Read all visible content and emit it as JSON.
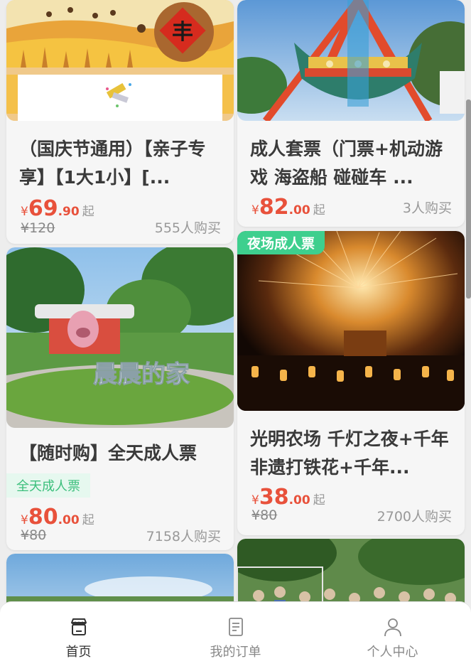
{
  "cards": [
    {
      "title": "（国庆节通用）【亲子专享】【1大1小】[...",
      "price_yen": "¥",
      "price_int": "69",
      "price_dec": ".90",
      "price_suffix": "起",
      "original_price": "¥120",
      "sold": "555人购买",
      "banner_char": "丰"
    },
    {
      "title": "成人套票（门票+机动游戏 海盗船 碰碰车 ...",
      "price_yen": "¥",
      "price_int": "82",
      "price_dec": ".00",
      "price_suffix": "起",
      "sold": "3人购买"
    },
    {
      "title": "【随时购】全天成人票",
      "tag": "全天成人票",
      "price_yen": "¥",
      "price_int": "80",
      "price_dec": ".00",
      "price_suffix": "起",
      "original_price": "¥80",
      "sold": "7158人购买",
      "image_text": "晨晨的家"
    },
    {
      "corner_tag": "夜场成人票",
      "title": "光明农场 千灯之夜+千年非遗打铁花+千年...",
      "price_yen": "¥",
      "price_int": "38",
      "price_dec": ".00",
      "price_suffix": "起",
      "original_price": "¥80",
      "sold": "2700人购买"
    }
  ],
  "tabbar": {
    "home": "首页",
    "orders": "我的订单",
    "profile": "个人中心"
  },
  "colors": {
    "price": "#e8513b",
    "tag_green": "#3ecf8e",
    "background": "#ededed"
  }
}
